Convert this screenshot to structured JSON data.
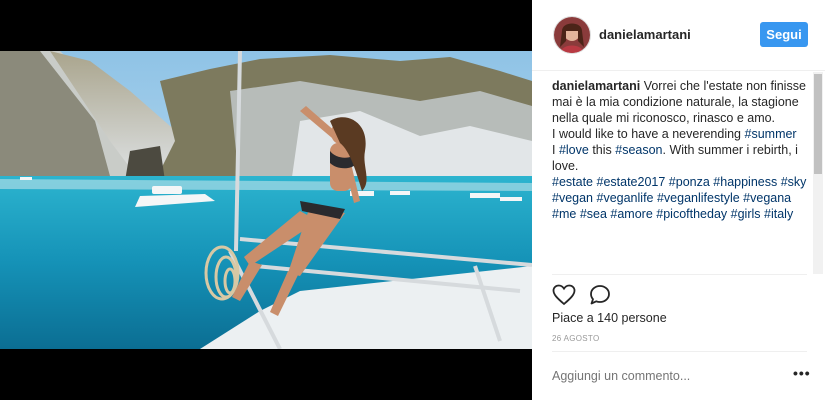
{
  "post": {
    "username": "danielamartani",
    "follow_label": "Segui",
    "caption": [
      [
        {
          "t": "danielamartani",
          "u": true
        },
        {
          "t": " Vorrei che l'estate non finisse mai è la mia condizione naturale, la stagione nella quale mi riconosco, rinasco e amo."
        }
      ],
      [
        {
          "t": "I would like to have a neverending "
        },
        {
          "t": "#summer",
          "h": true
        }
      ],
      [
        {
          "t": "I "
        },
        {
          "t": "#love",
          "h": true
        },
        {
          "t": " this "
        },
        {
          "t": "#season",
          "h": true
        },
        {
          "t": ". With summer i rebirth, i love."
        }
      ],
      [
        {
          "t": "#estate",
          "h": true
        },
        {
          "t": " "
        },
        {
          "t": "#estate2017",
          "h": true
        },
        {
          "t": " "
        },
        {
          "t": "#ponza",
          "h": true
        },
        {
          "t": " "
        },
        {
          "t": "#happiness",
          "h": true
        },
        {
          "t": " "
        },
        {
          "t": "#sky",
          "h": true
        },
        {
          "t": " "
        },
        {
          "t": "#vegan",
          "h": true
        },
        {
          "t": " "
        },
        {
          "t": "#veganlife",
          "h": true
        },
        {
          "t": " "
        },
        {
          "t": "#veganlifestyle",
          "h": true
        },
        {
          "t": " "
        },
        {
          "t": "#vegana",
          "h": true
        },
        {
          "t": " "
        },
        {
          "t": "#me",
          "h": true
        },
        {
          "t": " "
        },
        {
          "t": "#sea",
          "h": true
        },
        {
          "t": " "
        },
        {
          "t": "#amore",
          "h": true
        },
        {
          "t": " "
        },
        {
          "t": "#picoftheday",
          "h": true
        },
        {
          "t": " "
        },
        {
          "t": "#girls",
          "h": true
        },
        {
          "t": " "
        },
        {
          "t": "#italy",
          "h": true
        }
      ]
    ],
    "likes_text": "Piace a 140 persone",
    "date": "26 AGOSTO",
    "comment_placeholder": "Aggiungi un commento...",
    "more_label": "•••"
  },
  "icons": {
    "like": "heart-icon",
    "comment": "comment-icon"
  },
  "colors": {
    "follow_button": "#3897f0",
    "hashtag": "#003569",
    "username": "#262626",
    "muted": "#999999",
    "sea": "#1aa0c0"
  }
}
